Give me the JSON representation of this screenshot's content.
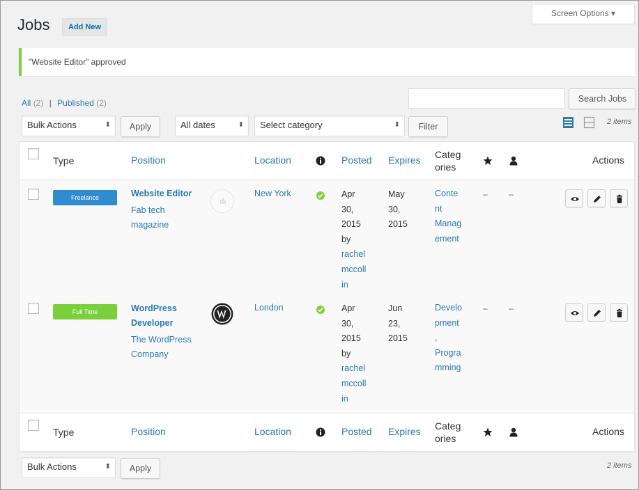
{
  "header": {
    "screen_options": "Screen Options ▾",
    "title": "Jobs",
    "add_new": "Add New"
  },
  "notice": {
    "text": "\"Website Editor\" approved"
  },
  "views": {
    "all_label": "All",
    "all_count": "(2)",
    "separator": "|",
    "published_label": "Published",
    "published_count": "(2)"
  },
  "search": {
    "input_value": "",
    "button": "Search Jobs"
  },
  "filters": {
    "bulk_actions": "Bulk Actions",
    "apply": "Apply",
    "dates": "All dates",
    "category": "Select category",
    "filter": "Filter",
    "items_count": "2 items"
  },
  "columns": {
    "type": "Type",
    "position": "Position",
    "location": "Location",
    "posted": "Posted",
    "expires": "Expires",
    "categories_line1": "Categ",
    "categories_line2": "ories",
    "actions": "Actions"
  },
  "rows": [
    {
      "type": "Freelance",
      "type_color": "#2e8ccf",
      "title": "Website Editor",
      "company_line1": "Fab tech",
      "company_line2": "magazine",
      "logo": "placeholder-logo-icon",
      "location": "New York",
      "status": "approved",
      "posted": [
        "Apr",
        "30,",
        "2015",
        "by"
      ],
      "posted_author": [
        "rachel",
        "mccoll",
        "in"
      ],
      "expires": [
        "May",
        "30,",
        "2015"
      ],
      "categories": [
        "Conte",
        "nt",
        "Manag",
        "ement"
      ],
      "featured": "–",
      "filled": "–"
    },
    {
      "type": "Full Time",
      "type_color": "#7ad03a",
      "title_line1": "WordPress",
      "title_line2": "Developer",
      "company_line1": "The WordPress",
      "company_line2": "Company",
      "logo": "wordpress-logo-icon",
      "location": "London",
      "status": "approved",
      "posted": [
        "Apr",
        "30,",
        "2015",
        "by"
      ],
      "posted_author": [
        "rachel",
        "mccoll",
        "in"
      ],
      "expires": [
        "Jun",
        "23,",
        "2015"
      ],
      "categories": [
        "Develo",
        "pment",
        ",",
        "Progra",
        "mming"
      ],
      "featured": "–",
      "filled": "–"
    }
  ],
  "colors": {
    "accent_link": "#2a7ab0",
    "approved_green": "#7ad03a",
    "freelance_blue": "#2e8ccf"
  }
}
